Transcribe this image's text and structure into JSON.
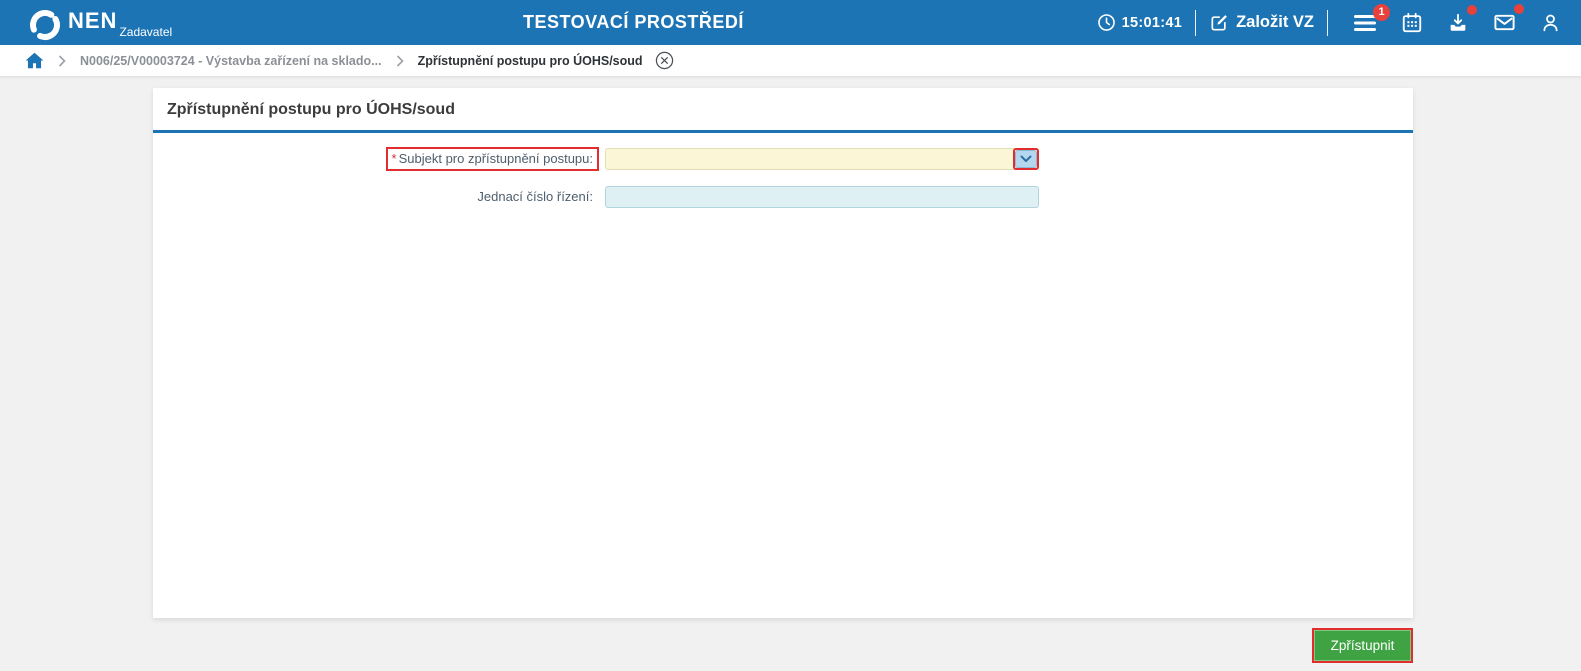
{
  "header": {
    "brand": "NEN",
    "brand_subtitle": "Zadavatel",
    "environment_title": "TESTOVACÍ PROSTŘEDÍ",
    "clock_time": "15:01:41",
    "create_vz_label": "Založit VZ",
    "menu_badge": "1"
  },
  "breadcrumb": {
    "items": [
      {
        "label": "N006/25/V00003724 - Výstavba zařízení na sklado..."
      },
      {
        "label": "Zpřístupnění postupu pro ÚOHS/soud"
      }
    ]
  },
  "main": {
    "card_title": "Zpřístupnění postupu pro ÚOHS/soud",
    "form": {
      "fields": [
        {
          "label": "Subjekt pro zpřístupnění postupu:",
          "required_mark": "*",
          "type": "select",
          "value": "",
          "highlighted": true
        },
        {
          "label": "Jednací číslo řízení:",
          "type": "text",
          "value": "",
          "highlighted": false
        }
      ]
    }
  },
  "footer": {
    "submit_label": "Zpřístupnit"
  },
  "colors": {
    "header_blue": "#1d74b4",
    "annotation_red": "#e12d2d",
    "button_green": "#3fa343",
    "badge_red": "#e8413c",
    "field_yellow": "#fbf7d6",
    "field_cyan": "#dff0f4",
    "page_background": "#f1f1f1"
  }
}
